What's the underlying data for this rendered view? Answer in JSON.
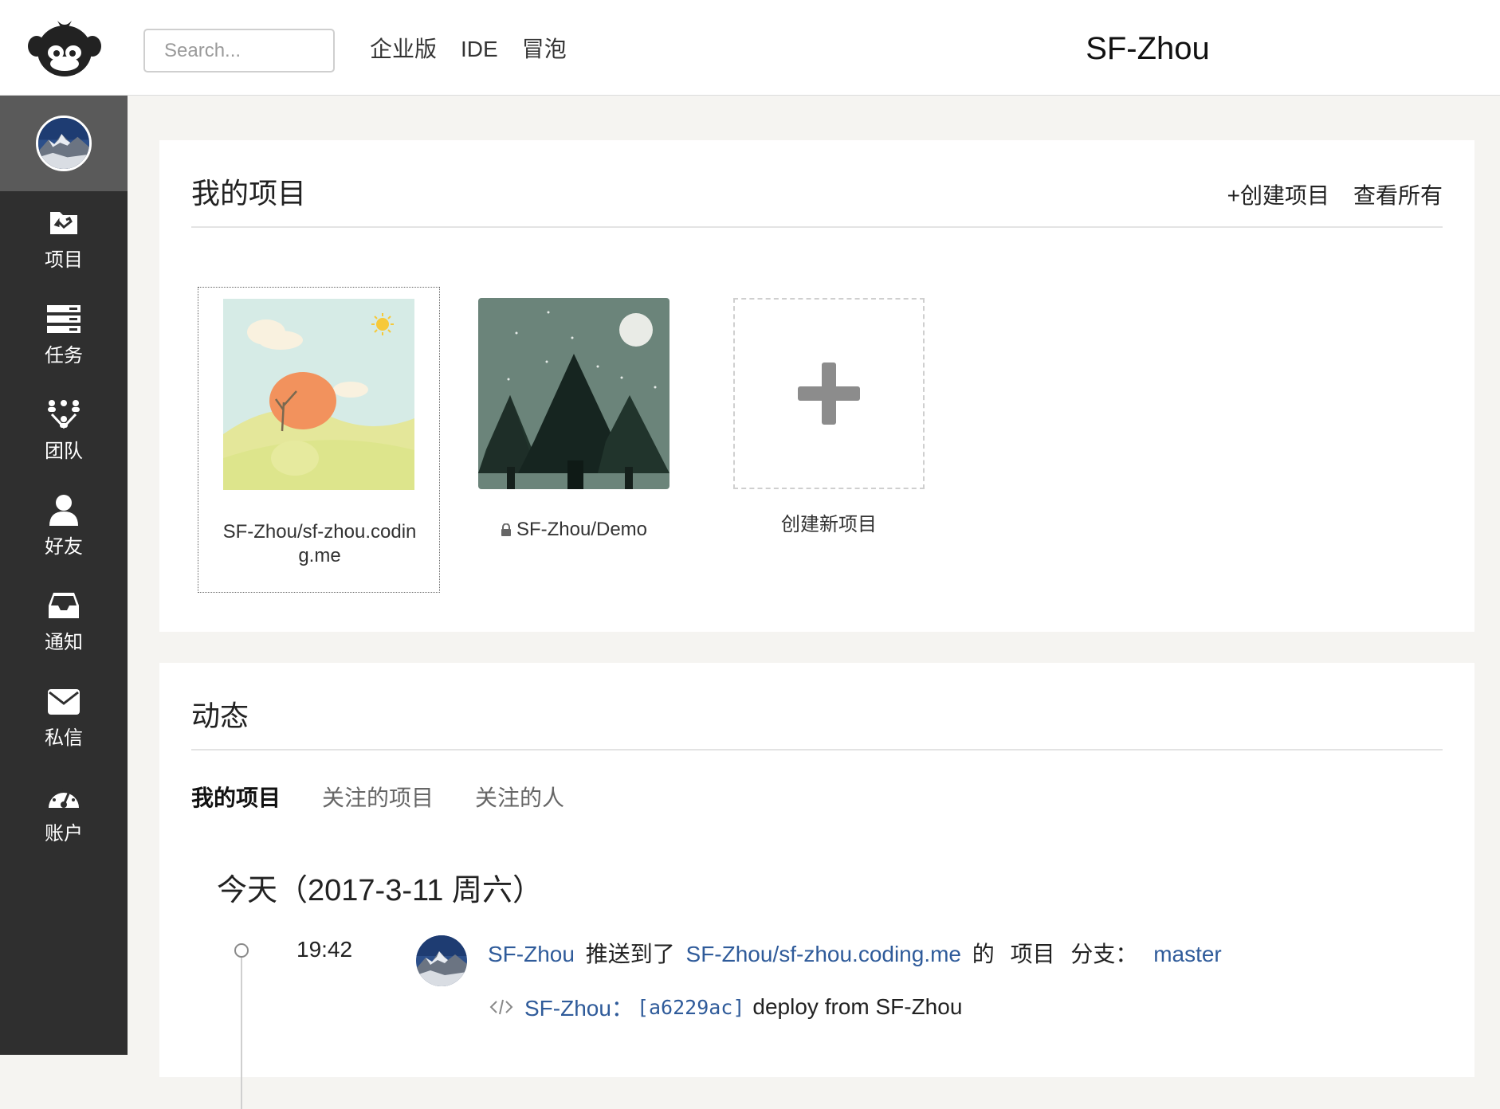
{
  "header": {
    "search_placeholder": "Search...",
    "nav": [
      "企业版",
      "IDE",
      "冒泡"
    ],
    "username": "SF-Zhou"
  },
  "sidebar": {
    "items": [
      {
        "label": "项目",
        "icon": "folder-icon"
      },
      {
        "label": "任务",
        "icon": "tasks-icon"
      },
      {
        "label": "团队",
        "icon": "team-icon"
      },
      {
        "label": "好友",
        "icon": "user-icon"
      },
      {
        "label": "通知",
        "icon": "inbox-icon"
      },
      {
        "label": "私信",
        "icon": "envelope-icon"
      },
      {
        "label": "账户",
        "icon": "dashboard-icon"
      }
    ]
  },
  "projects_card": {
    "title": "我的项目",
    "create_label": "+创建项目",
    "view_all_label": "查看所有",
    "projects": [
      {
        "name": "SF-Zhou/sf-zhou.coding.me",
        "private": false
      },
      {
        "name": "SF-Zhou/Demo",
        "private": true
      }
    ],
    "new_project_label": "创建新项目"
  },
  "activity_card": {
    "title": "动态",
    "tabs": [
      "我的项目",
      "关注的项目",
      "关注的人"
    ],
    "active_tab": 0,
    "day_heading": "今天（2017-3-11 周六）",
    "events": [
      {
        "time": "19:42",
        "actor": "SF-Zhou",
        "verb": "推送到了",
        "project": "SF-Zhou/sf-zhou.coding.me",
        "of": "的",
        "project_word": "项目",
        "branch_word": "分支：",
        "branch": "master",
        "commit_author": "SF-Zhou：",
        "commit_hash": "[a6229ac]",
        "commit_message": "deploy from SF-Zhou"
      }
    ]
  },
  "colors": {
    "sidebar_bg": "#2f2f2f",
    "link": "#2f5b9a",
    "page_bg": "#f5f4f1"
  }
}
